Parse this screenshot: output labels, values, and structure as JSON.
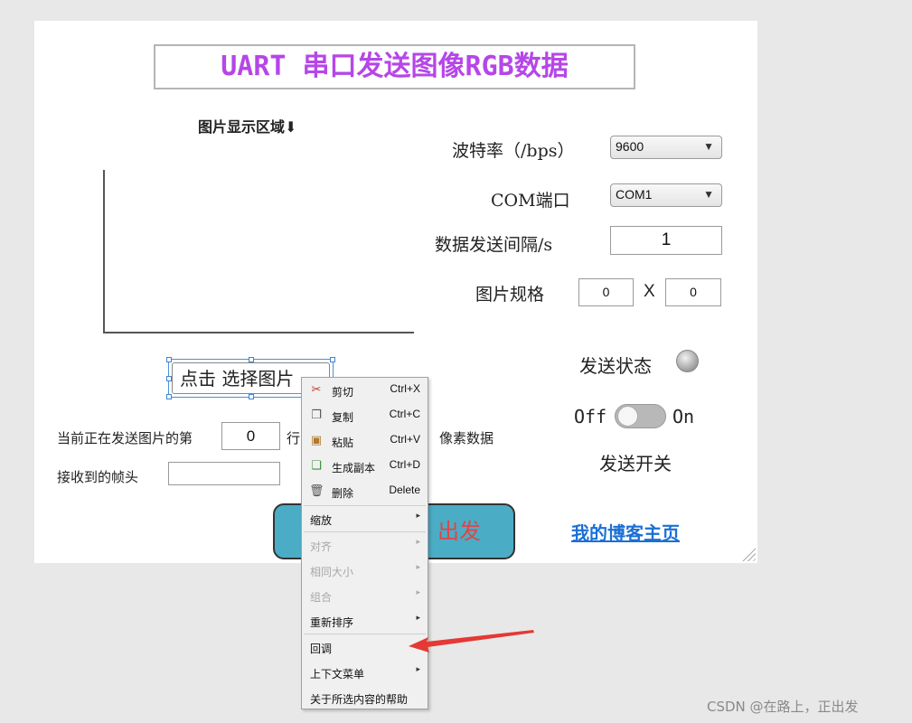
{
  "app": {
    "title": "UART 串口发送图像RGB数据",
    "image_area_label": "图片显示区域",
    "image_area_arrow": "⬇",
    "select_image_button": "点击 选择图片",
    "baud_label": "波特率（/bps）",
    "baud_value": "9600",
    "com_label": "COM端口",
    "com_value": "COM1",
    "interval_label": "数据发送间隔/s",
    "interval_value": "1",
    "size_label": "图片规格",
    "width_value": "0",
    "size_x": "X",
    "height_value": "0",
    "status_label": "发送状态",
    "toggle_off": "Off",
    "toggle_on": "On",
    "switch_label": "发送开关",
    "row_prefix": "当前正在发送图片的第",
    "row_value": "0",
    "row_mid": "行",
    "row_suffix": "像素数据",
    "header_label": "接收到的帧头",
    "header_value": "",
    "start_button": "出发",
    "blog_link": "我的博客主页"
  },
  "context_menu": {
    "items": [
      {
        "label": "剪切",
        "shortcut": "Ctrl+X",
        "icon": "scissors-icon"
      },
      {
        "label": "复制",
        "shortcut": "Ctrl+C",
        "icon": "copy-icon"
      },
      {
        "label": "粘贴",
        "shortcut": "Ctrl+V",
        "icon": "paste-icon"
      },
      {
        "label": "生成副本",
        "shortcut": "Ctrl+D",
        "icon": "duplicate-icon"
      },
      {
        "label": "删除",
        "shortcut": "Delete",
        "icon": "trash-icon"
      },
      {
        "label": "缩放"
      },
      {
        "label": "对齐"
      },
      {
        "label": "相同大小"
      },
      {
        "label": "组合"
      },
      {
        "label": "重新排序"
      },
      {
        "label": "回调"
      },
      {
        "label": "上下文菜单"
      },
      {
        "label": "关于所选内容的帮助"
      }
    ]
  },
  "watermark": "CSDN @在路上，正出发",
  "colors": {
    "title": "#b646e8",
    "start_button_bg": "#4bacc6",
    "start_button_text": "#e04545",
    "link": "#1b6fd6",
    "annotation_arrow": "#e53935"
  }
}
